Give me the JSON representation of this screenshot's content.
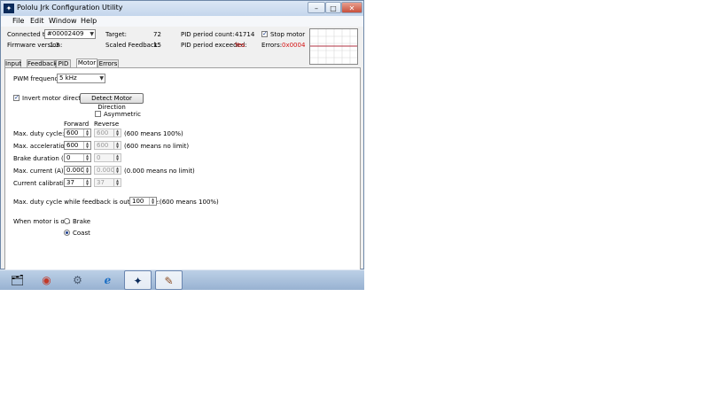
{
  "window": {
    "title": "Pololu Jrk Configuration Utility",
    "controls": {
      "minimize": "–",
      "maximize": "□",
      "close": "✕"
    }
  },
  "menu": [
    "File",
    "Edit",
    "Window",
    "Help"
  ],
  "header": {
    "connected_label": "Connected to:",
    "connected_value": "#00002409",
    "firmware_label": "Firmware version:",
    "firmware_value": "1.3",
    "target_label": "Target:",
    "target_value": "72",
    "scaled_label": "Scaled Feedback:",
    "scaled_value": "15",
    "pid_count_label": "PID period count:",
    "pid_count_value": "41714",
    "pid_exceeded_label": "PID period exceeded:",
    "pid_exceeded_value": "Yes",
    "stop_motor_label": "Stop motor",
    "errors_label": "Errors:",
    "errors_value": "0x0004"
  },
  "tabs": [
    "Input",
    "Feedback",
    "PID",
    "Motor",
    "Errors"
  ],
  "motor": {
    "pwm_label": "PWM frequency:",
    "pwm_value": "5 kHz",
    "invert_label": "Invert motor direction",
    "detect_button": "Detect Motor Direction",
    "asymmetric_label": "Asymmetric",
    "col_forward": "Forward",
    "col_reverse": "Reverse",
    "rows": [
      {
        "label": "Max. duty cycle:",
        "forward": "600",
        "reverse": "600",
        "note": "(600 means 100%)"
      },
      {
        "label": "Max. acceleration:",
        "forward": "600",
        "reverse": "600",
        "note": "(600 means no limit)"
      },
      {
        "label": "Brake duration (ms):",
        "forward": "0",
        "reverse": "0",
        "note": ""
      },
      {
        "label": "Max. current (A):",
        "forward": "0.000",
        "reverse": "0.000",
        "note": "(0.000 means no limit)"
      },
      {
        "label": "Current calibration:",
        "forward": "37",
        "reverse": "37",
        "note": ""
      }
    ],
    "oor_label": "Max. duty cycle while feedback is out of range:",
    "oor_value": "100",
    "oor_note": "(600 means 100%)",
    "off_label": "When motor is off:",
    "off_brake": "Brake",
    "off_coast": "Coast"
  },
  "taskbar": {
    "items": [
      {
        "icon": "folder-icon",
        "glyph": "🗂"
      },
      {
        "icon": "chrome-icon",
        "glyph": "◉"
      },
      {
        "icon": "network-icon",
        "glyph": "⚙"
      },
      {
        "icon": "internet-explorer-icon",
        "glyph": "ℯ"
      },
      {
        "icon": "pololu-icon",
        "glyph": "✦"
      },
      {
        "icon": "paint-icon",
        "glyph": "✎"
      }
    ]
  },
  "colors": {
    "error_red": "#d41010",
    "chart_line": "#b03040",
    "accent": "#1f3f8f"
  }
}
